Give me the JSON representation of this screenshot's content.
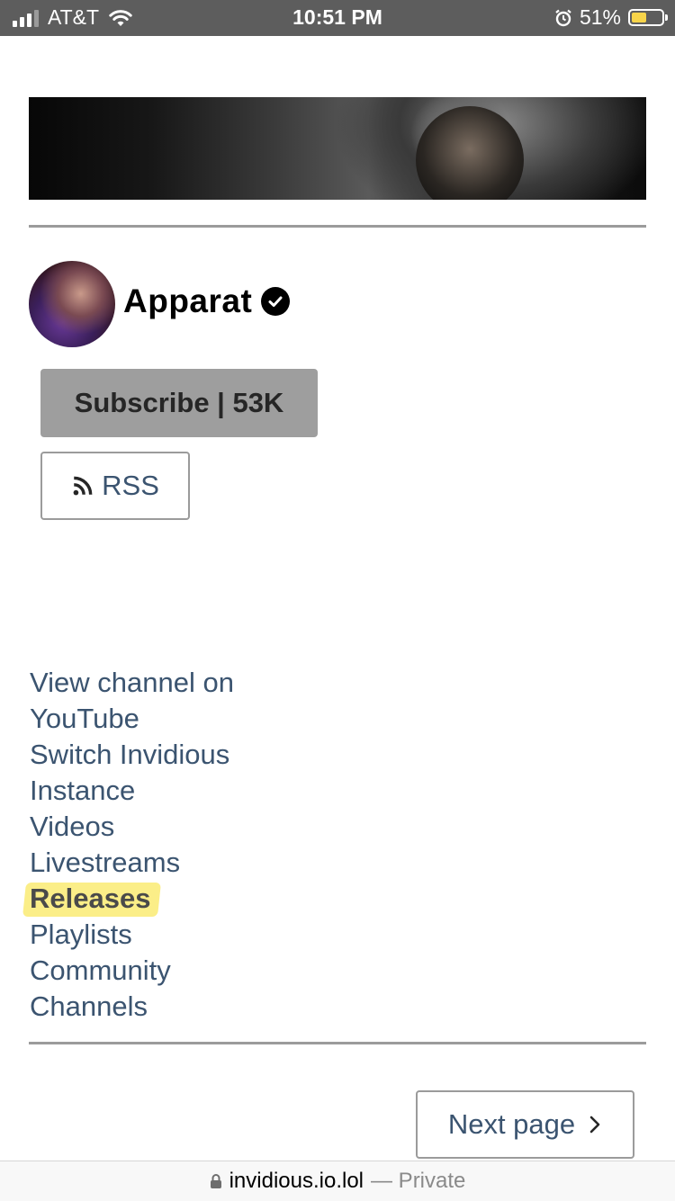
{
  "status_bar": {
    "carrier": "AT&T",
    "time": "10:51 PM",
    "battery_percent": "51%",
    "battery_level": 0.51
  },
  "channel": {
    "name": "Apparat",
    "verified": true,
    "subscribe_label": "Subscribe | 53K",
    "rss_label": "RSS"
  },
  "nav": {
    "view_channel_line1": "View channel on",
    "view_channel_line2": "YouTube",
    "switch_instance_line1": "Switch Invidious",
    "switch_instance_line2": "Instance",
    "videos": "Videos",
    "livestreams": "Livestreams",
    "releases": "Releases",
    "playlists": "Playlists",
    "community": "Community",
    "channels": "Channels"
  },
  "pagination": {
    "next_label": "Next page"
  },
  "browser": {
    "host": "invidious.io.lol",
    "mode": "— Private"
  },
  "colors": {
    "status_bar_bg": "#5d5d5d",
    "link": "#3b5470",
    "subscribe_bg": "#9e9e9e",
    "highlight": "#fbee88",
    "battery_fill": "#f7d44a"
  }
}
